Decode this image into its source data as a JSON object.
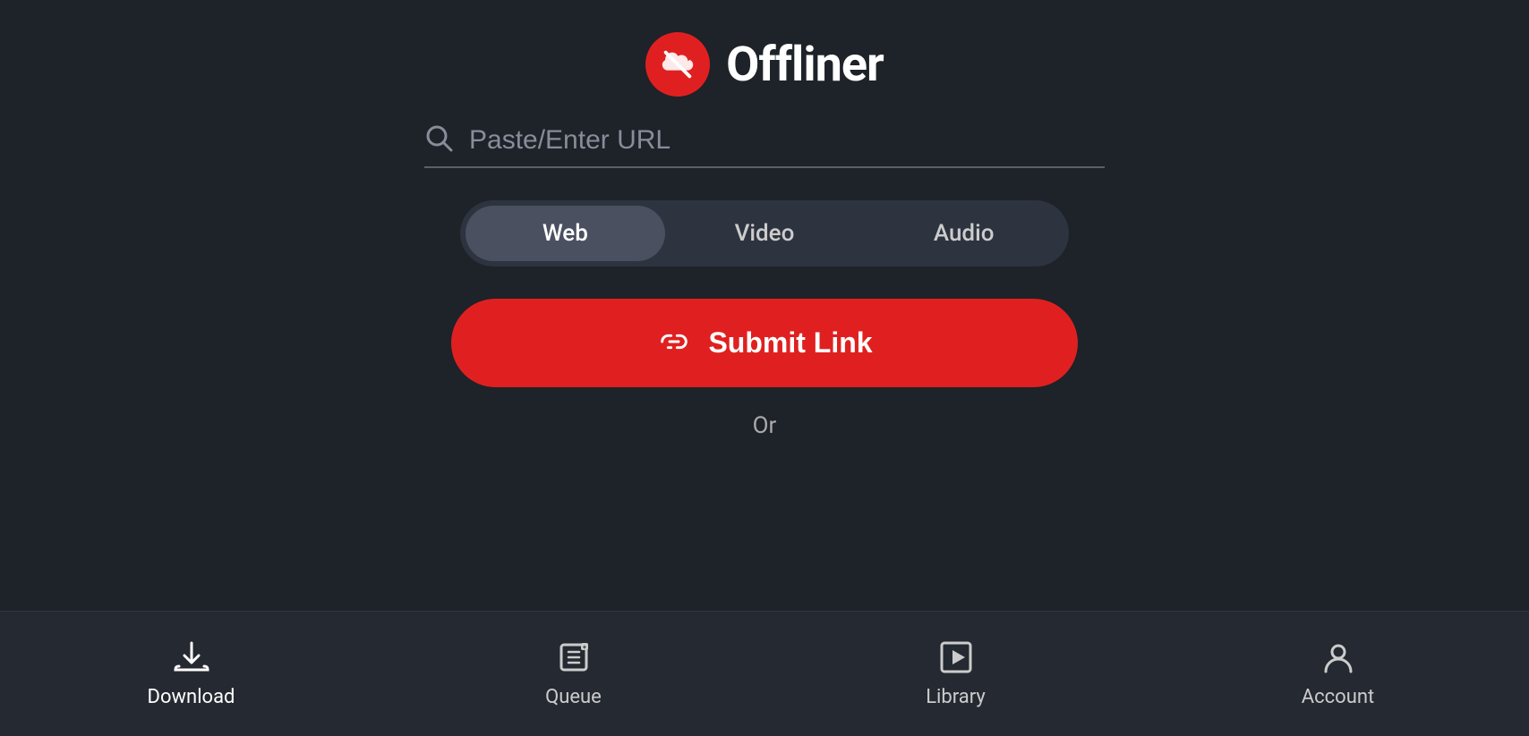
{
  "app": {
    "title": "Offliner"
  },
  "search": {
    "placeholder": "Paste/Enter URL"
  },
  "tabs": [
    {
      "id": "web",
      "label": "Web",
      "active": true
    },
    {
      "id": "video",
      "label": "Video",
      "active": false
    },
    {
      "id": "audio",
      "label": "Audio",
      "active": false
    }
  ],
  "submit_button": {
    "label": "Submit Link"
  },
  "or_text": "Or",
  "bottom_nav": [
    {
      "id": "download",
      "label": "Download",
      "icon": "download",
      "active": true
    },
    {
      "id": "queue",
      "label": "Queue",
      "icon": "queue",
      "active": false
    },
    {
      "id": "library",
      "label": "Library",
      "icon": "library",
      "active": false
    },
    {
      "id": "account",
      "label": "Account",
      "icon": "account",
      "active": false
    }
  ],
  "colors": {
    "brand_red": "#e02020",
    "bg_dark": "#1e2229",
    "bg_nav": "#252a32",
    "tab_active": "#4a5060"
  }
}
